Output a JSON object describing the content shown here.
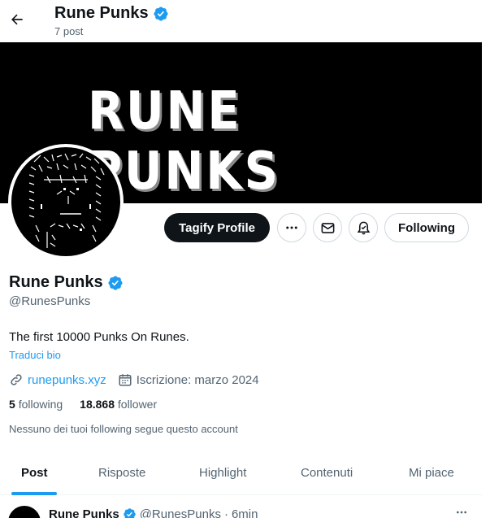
{
  "header": {
    "title": "Rune Punks",
    "post_count": "7 post"
  },
  "banner": {
    "text": "RUNE PUNKS"
  },
  "actions": {
    "tagify_label": "Tagify Profile",
    "following_label": "Following"
  },
  "profile": {
    "name": "Rune Punks",
    "handle": "@RunesPunks",
    "bio": "The first 10000 Punks On Runes.",
    "translate_bio": "Traduci bio",
    "website": "runepunks.xyz",
    "joined": "Iscrizione: marzo 2024",
    "following_count": "5",
    "following_label": "following",
    "followers_count": "18.868",
    "followers_label": "follower",
    "no_mutuals": "Nessuno dei tuoi following segue questo account"
  },
  "tabs": [
    {
      "label": "Post"
    },
    {
      "label": "Risposte"
    },
    {
      "label": "Highlight"
    },
    {
      "label": "Contenuti"
    },
    {
      "label": "Mi piace"
    }
  ],
  "post": {
    "name": "Rune Punks",
    "handle": "@RunesPunks",
    "separator": "·",
    "time": "6min"
  },
  "colors": {
    "accent": "#1d9bf0",
    "text": "#0f1419",
    "muted": "#536471"
  },
  "icons": [
    "back-arrow-icon",
    "verified-badge-icon",
    "more-icon",
    "mail-icon",
    "notification-bell-icon",
    "link-icon",
    "calendar-icon"
  ]
}
